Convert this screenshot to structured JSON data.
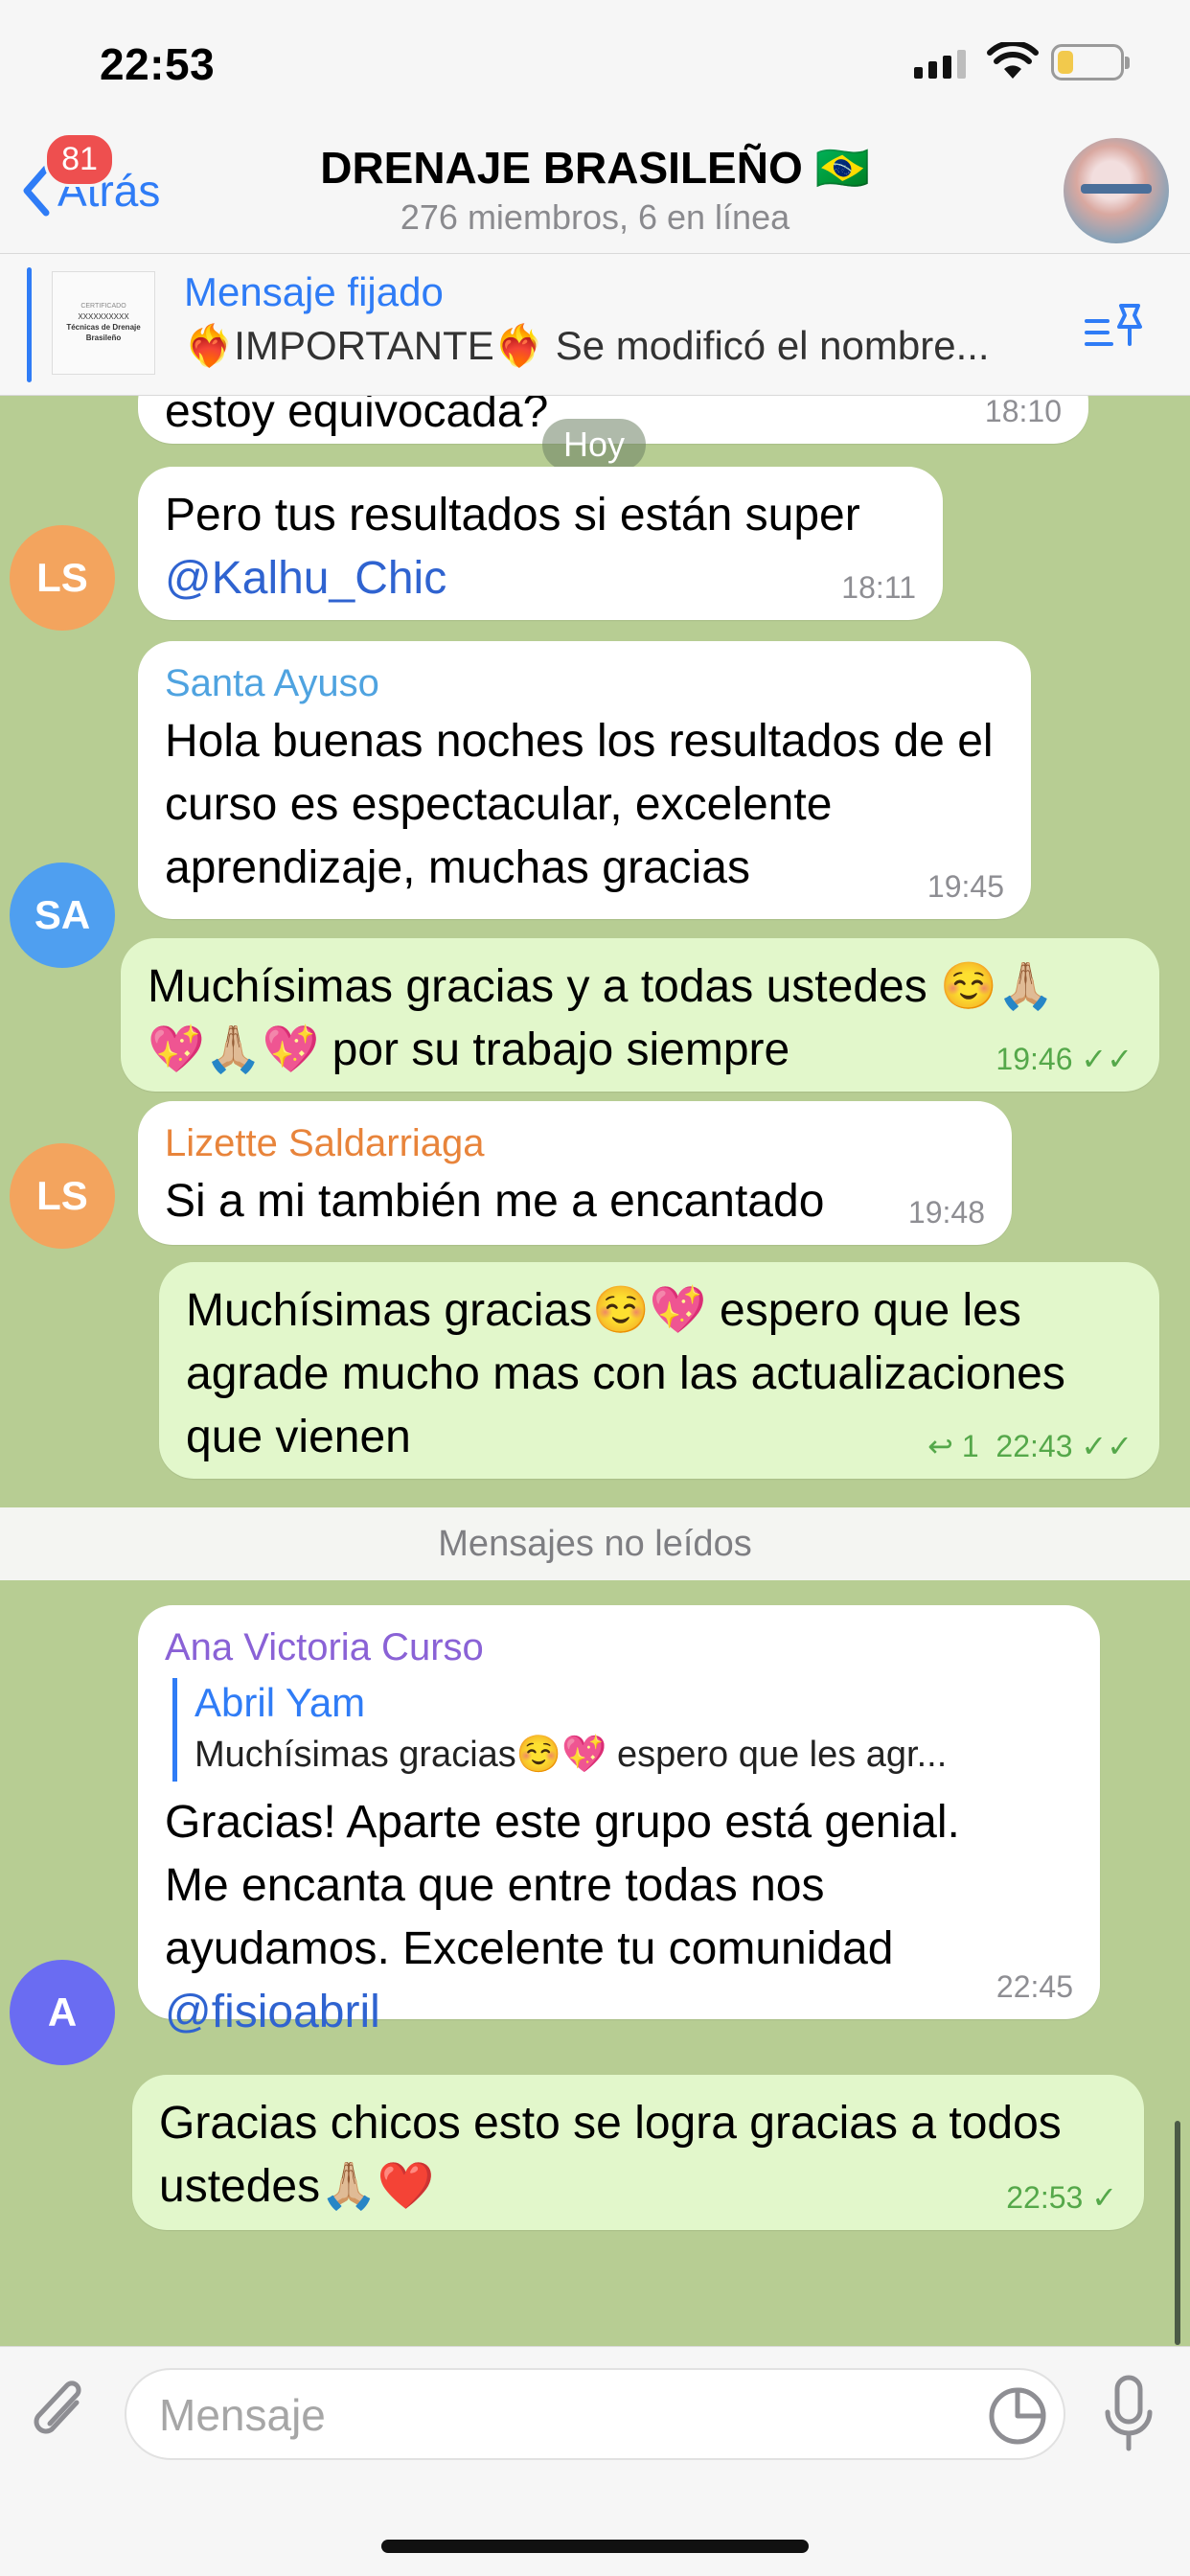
{
  "status_bar": {
    "time": "22:53"
  },
  "header": {
    "back_label": "Atrás",
    "unread_badge": "81",
    "title": "DRENAJE BRASILEÑO 🇧🇷",
    "subtitle": "276 miembros, 6 en línea"
  },
  "pinned": {
    "label": "Mensaje fijado",
    "text": "❤️‍🔥IMPORTANTE❤️‍🔥 Se modificó el nombre...",
    "thumb_cert": "CERTIFICADO",
    "thumb_name": "XXXXXXXXXX",
    "thumb_title": "Técnicas de Drenaje Brasileño"
  },
  "chat": {
    "date_pill": "Hoy",
    "unread_divider": "Mensajes no leídos",
    "messages": [
      {
        "id": "m0",
        "text": "estoy equivocada?",
        "time": "18:10"
      },
      {
        "id": "m1",
        "avatar": "LS",
        "text": "Pero tus resultados si están super",
        "mention": "@Kalhu_Chic",
        "time": "18:11"
      },
      {
        "id": "m2",
        "avatar": "SA",
        "sender": "Santa Ayuso",
        "text": "Hola buenas noches los resultados de el curso es espectacular, excelente aprendizaje, muchas gracias",
        "time": "19:45"
      },
      {
        "id": "m3",
        "text": "Muchísimas gracias y a todas ustedes ☺️🙏🏼💖🙏🏼💖 por su trabajo siempre",
        "time": "19:46"
      },
      {
        "id": "m4",
        "avatar": "LS",
        "sender": "Lizette Saldarriaga",
        "text": "Si a mi también me a encantado",
        "time": "19:48"
      },
      {
        "id": "m5",
        "text": "Muchísimas gracias☺️💖 espero que les agrade mucho mas con las actualizaciones que vienen",
        "time": "22:43",
        "replies": "1"
      },
      {
        "id": "m6",
        "avatar": "A",
        "sender": "Ana Victoria Curso",
        "reply_name": "Abril Yam",
        "reply_text": "Muchísimas gracias☺️💖 espero que les agr...",
        "text": "Gracias! Aparte este grupo está genial. Me encanta que entre todas nos ayudamos. Excelente tu comunidad",
        "mention": "@fisioabril",
        "time": "22:45"
      },
      {
        "id": "m7",
        "text": "Gracias chicos esto se logra gracias a todos ustedes🙏🏼❤️",
        "time": "22:53"
      }
    ]
  },
  "composer": {
    "placeholder": "Mensaje"
  },
  "colors": {
    "accent": "#2f7cf6",
    "ls_avatar": "#f3a45e",
    "sa_avatar": "#4f9ff0",
    "a_avatar": "#6a6cf2",
    "santa_name": "#4fa3e0",
    "lizette_name": "#e8843b",
    "ana_name": "#8a62d6"
  }
}
